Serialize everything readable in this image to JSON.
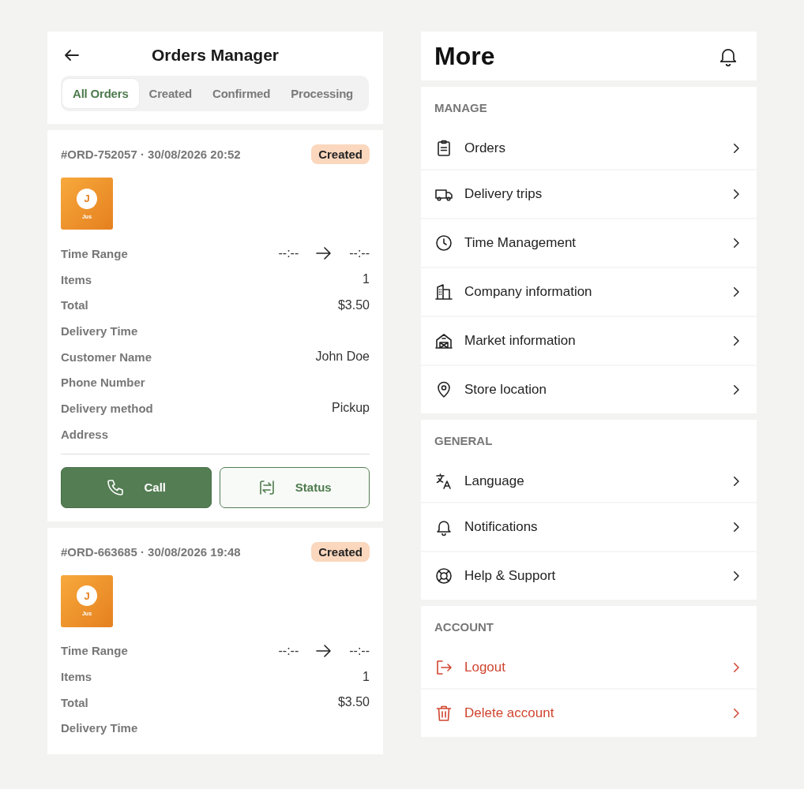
{
  "orders_screen": {
    "title": "Orders Manager",
    "tabs": [
      {
        "label": "All Orders",
        "selected": true
      },
      {
        "label": "Created",
        "selected": false
      },
      {
        "label": "Confirmed",
        "selected": false
      },
      {
        "label": "Processing",
        "selected": false
      }
    ],
    "orders": [
      {
        "heading": "#ORD-752057 · 30/08/2026 20:52",
        "status": "Created",
        "avatar": {
          "initial": "J",
          "caption": "Jus"
        },
        "time_range": {
          "label": "Time Range",
          "from": "--:--",
          "to": "--:--"
        },
        "fields": [
          {
            "label": "Items",
            "value": "1"
          },
          {
            "label": "Total",
            "value": "$3.50"
          },
          {
            "label": "Delivery Time"
          },
          {
            "label": "Customer Name",
            "value": "John Doe"
          },
          {
            "label": "Phone Number"
          },
          {
            "label": "Delivery method",
            "value": "Pickup"
          },
          {
            "label": "Address"
          }
        ],
        "buttons": [
          {
            "label": "Call",
            "kind": "primary"
          },
          {
            "label": "Status",
            "kind": "outline"
          }
        ]
      },
      {
        "heading": "#ORD-663685 · 30/08/2026 19:48",
        "status": "Created",
        "avatar": {
          "initial": "J",
          "caption": "Jus"
        },
        "time_range": {
          "label": "Time Range",
          "from": "--:--",
          "to": "--:--"
        },
        "fields": [
          {
            "label": "Items",
            "value": "1"
          },
          {
            "label": "Total",
            "value": "$3.50"
          },
          {
            "label": "Delivery Time"
          }
        ]
      }
    ]
  },
  "more_screen": {
    "title": "More",
    "sections": [
      {
        "heading": "MANAGE",
        "items": [
          {
            "label": "Orders",
            "kind": "normal"
          },
          {
            "label": "Delivery trips",
            "kind": "normal"
          },
          {
            "label": "Time Management",
            "kind": "normal"
          },
          {
            "label": "Company information",
            "kind": "normal"
          },
          {
            "label": "Market information",
            "kind": "normal"
          },
          {
            "label": "Store location",
            "kind": "normal"
          }
        ]
      },
      {
        "heading": "GENERAL",
        "items": [
          {
            "label": "Language",
            "kind": "normal"
          },
          {
            "label": "Notifications",
            "kind": "normal"
          },
          {
            "label": "Help & Support",
            "kind": "normal"
          }
        ]
      },
      {
        "heading": "ACCOUNT",
        "items": [
          {
            "label": "Logout",
            "kind": "danger"
          },
          {
            "label": "Delete account",
            "kind": "danger"
          }
        ]
      }
    ]
  }
}
